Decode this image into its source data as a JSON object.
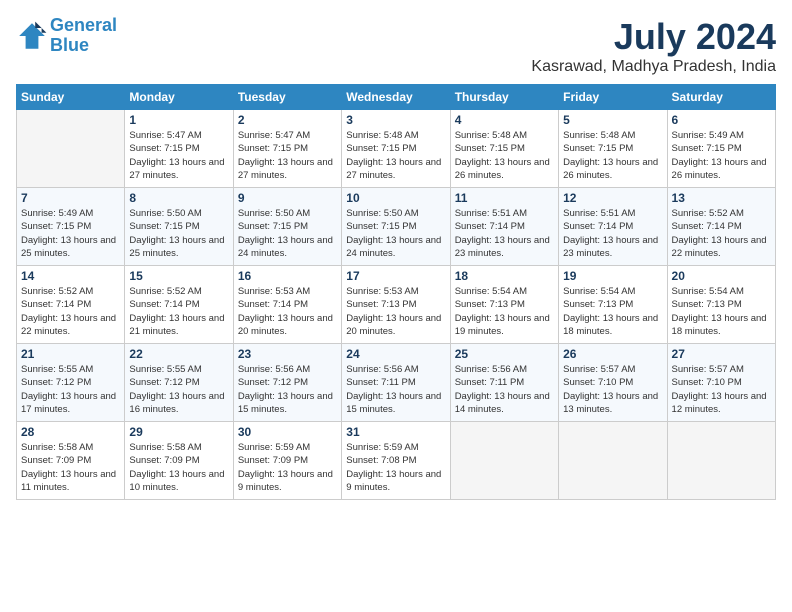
{
  "logo": {
    "line1": "General",
    "line2": "Blue"
  },
  "title": "July 2024",
  "location": "Kasrawad, Madhya Pradesh, India",
  "weekdays": [
    "Sunday",
    "Monday",
    "Tuesday",
    "Wednesday",
    "Thursday",
    "Friday",
    "Saturday"
  ],
  "weeks": [
    [
      {
        "day": "",
        "empty": true
      },
      {
        "day": "1",
        "sunrise": "5:47 AM",
        "sunset": "7:15 PM",
        "daylight": "13 hours and 27 minutes."
      },
      {
        "day": "2",
        "sunrise": "5:47 AM",
        "sunset": "7:15 PM",
        "daylight": "13 hours and 27 minutes."
      },
      {
        "day": "3",
        "sunrise": "5:48 AM",
        "sunset": "7:15 PM",
        "daylight": "13 hours and 27 minutes."
      },
      {
        "day": "4",
        "sunrise": "5:48 AM",
        "sunset": "7:15 PM",
        "daylight": "13 hours and 26 minutes."
      },
      {
        "day": "5",
        "sunrise": "5:48 AM",
        "sunset": "7:15 PM",
        "daylight": "13 hours and 26 minutes."
      },
      {
        "day": "6",
        "sunrise": "5:49 AM",
        "sunset": "7:15 PM",
        "daylight": "13 hours and 26 minutes."
      }
    ],
    [
      {
        "day": "7",
        "sunrise": "5:49 AM",
        "sunset": "7:15 PM",
        "daylight": "13 hours and 25 minutes."
      },
      {
        "day": "8",
        "sunrise": "5:50 AM",
        "sunset": "7:15 PM",
        "daylight": "13 hours and 25 minutes."
      },
      {
        "day": "9",
        "sunrise": "5:50 AM",
        "sunset": "7:15 PM",
        "daylight": "13 hours and 24 minutes."
      },
      {
        "day": "10",
        "sunrise": "5:50 AM",
        "sunset": "7:15 PM",
        "daylight": "13 hours and 24 minutes."
      },
      {
        "day": "11",
        "sunrise": "5:51 AM",
        "sunset": "7:14 PM",
        "daylight": "13 hours and 23 minutes."
      },
      {
        "day": "12",
        "sunrise": "5:51 AM",
        "sunset": "7:14 PM",
        "daylight": "13 hours and 23 minutes."
      },
      {
        "day": "13",
        "sunrise": "5:52 AM",
        "sunset": "7:14 PM",
        "daylight": "13 hours and 22 minutes."
      }
    ],
    [
      {
        "day": "14",
        "sunrise": "5:52 AM",
        "sunset": "7:14 PM",
        "daylight": "13 hours and 22 minutes."
      },
      {
        "day": "15",
        "sunrise": "5:52 AM",
        "sunset": "7:14 PM",
        "daylight": "13 hours and 21 minutes."
      },
      {
        "day": "16",
        "sunrise": "5:53 AM",
        "sunset": "7:14 PM",
        "daylight": "13 hours and 20 minutes."
      },
      {
        "day": "17",
        "sunrise": "5:53 AM",
        "sunset": "7:13 PM",
        "daylight": "13 hours and 20 minutes."
      },
      {
        "day": "18",
        "sunrise": "5:54 AM",
        "sunset": "7:13 PM",
        "daylight": "13 hours and 19 minutes."
      },
      {
        "day": "19",
        "sunrise": "5:54 AM",
        "sunset": "7:13 PM",
        "daylight": "13 hours and 18 minutes."
      },
      {
        "day": "20",
        "sunrise": "5:54 AM",
        "sunset": "7:13 PM",
        "daylight": "13 hours and 18 minutes."
      }
    ],
    [
      {
        "day": "21",
        "sunrise": "5:55 AM",
        "sunset": "7:12 PM",
        "daylight": "13 hours and 17 minutes."
      },
      {
        "day": "22",
        "sunrise": "5:55 AM",
        "sunset": "7:12 PM",
        "daylight": "13 hours and 16 minutes."
      },
      {
        "day": "23",
        "sunrise": "5:56 AM",
        "sunset": "7:12 PM",
        "daylight": "13 hours and 15 minutes."
      },
      {
        "day": "24",
        "sunrise": "5:56 AM",
        "sunset": "7:11 PM",
        "daylight": "13 hours and 15 minutes."
      },
      {
        "day": "25",
        "sunrise": "5:56 AM",
        "sunset": "7:11 PM",
        "daylight": "13 hours and 14 minutes."
      },
      {
        "day": "26",
        "sunrise": "5:57 AM",
        "sunset": "7:10 PM",
        "daylight": "13 hours and 13 minutes."
      },
      {
        "day": "27",
        "sunrise": "5:57 AM",
        "sunset": "7:10 PM",
        "daylight": "13 hours and 12 minutes."
      }
    ],
    [
      {
        "day": "28",
        "sunrise": "5:58 AM",
        "sunset": "7:09 PM",
        "daylight": "13 hours and 11 minutes."
      },
      {
        "day": "29",
        "sunrise": "5:58 AM",
        "sunset": "7:09 PM",
        "daylight": "13 hours and 10 minutes."
      },
      {
        "day": "30",
        "sunrise": "5:59 AM",
        "sunset": "7:09 PM",
        "daylight": "13 hours and 9 minutes."
      },
      {
        "day": "31",
        "sunrise": "5:59 AM",
        "sunset": "7:08 PM",
        "daylight": "13 hours and 9 minutes."
      },
      {
        "day": "",
        "empty": true
      },
      {
        "day": "",
        "empty": true
      },
      {
        "day": "",
        "empty": true
      }
    ]
  ]
}
